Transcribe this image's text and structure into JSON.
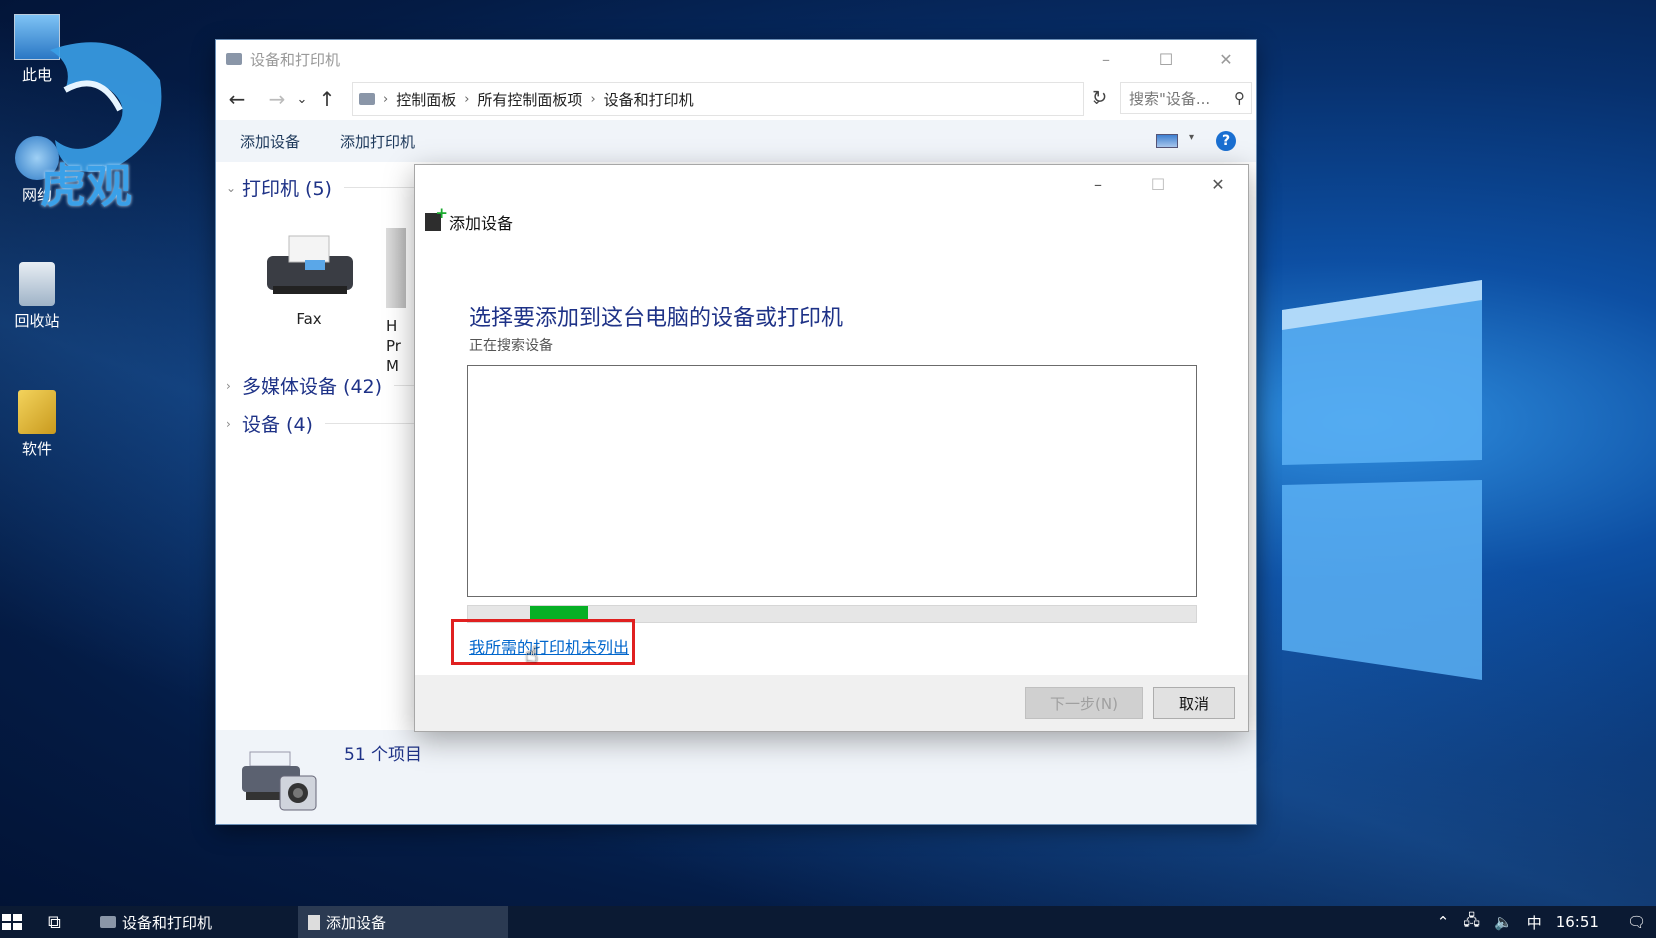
{
  "desktop": {
    "icons": [
      {
        "label": "此电"
      },
      {
        "label": "网约"
      },
      {
        "label": "回收站"
      },
      {
        "label": "软件"
      }
    ],
    "watermark_text": "虎观"
  },
  "explorer": {
    "title": "设备和打印机",
    "controls": {
      "min": "–",
      "max": "☐",
      "close": "✕"
    },
    "breadcrumbs": [
      "控制面板",
      "所有控制面板项",
      "设备和打印机"
    ],
    "search_placeholder": "搜索\"设备...",
    "commands": {
      "add_device": "添加设备",
      "add_printer": "添加打印机"
    },
    "groups": {
      "printers": "打印机 (5)",
      "media": "多媒体设备 (42)",
      "devices": "设备 (4)"
    },
    "printers": [
      {
        "label": "Fax"
      },
      {
        "label": "H\nPr\nM"
      }
    ],
    "status_count": "51 个项目"
  },
  "dialog": {
    "title": "添加设备",
    "heading": "选择要添加到这台电脑的设备或打印机",
    "subtitle": "正在搜索设备",
    "progress_fraction": 0.08,
    "link": "我所需的打印机未列出",
    "buttons": {
      "next": "下一步(N)",
      "cancel": "取消"
    }
  },
  "taskbar": {
    "items": [
      {
        "label": "设备和打印机"
      },
      {
        "label": "添加设备"
      }
    ],
    "ime": "中",
    "time": "16:51"
  }
}
